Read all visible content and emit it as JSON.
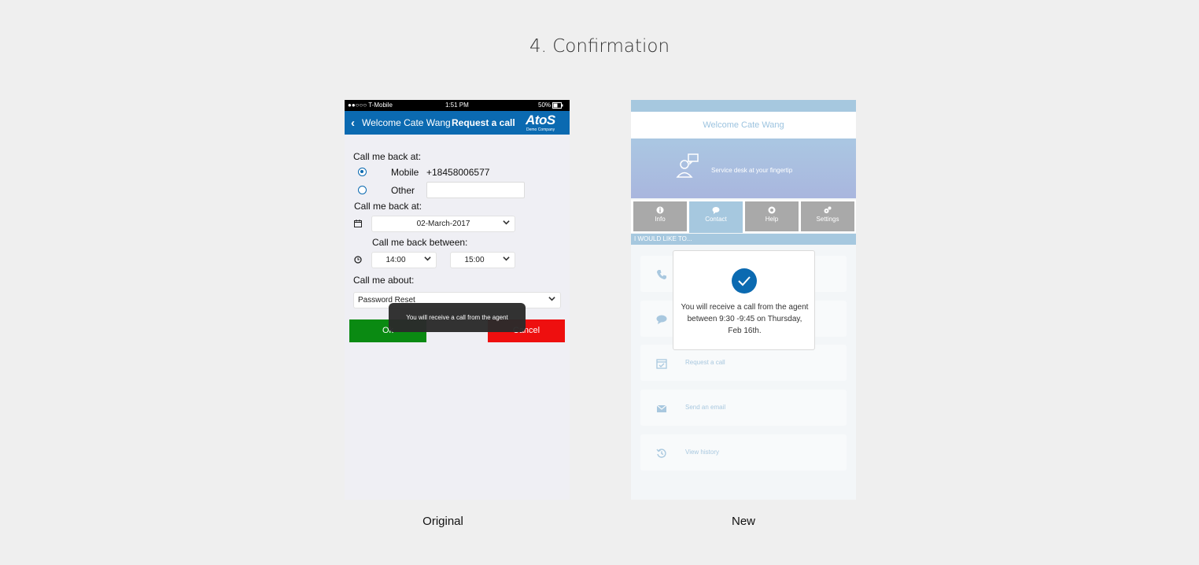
{
  "page": {
    "title": "4. Confirmation"
  },
  "captions": {
    "original": "Original",
    "new": "New"
  },
  "original": {
    "status": {
      "carrier": "●●○○○ T-Mobile",
      "time": "1:51 PM",
      "battery": "50%"
    },
    "nav": {
      "back_label": "Welcome Cate Wang",
      "title": "Request a call",
      "logo": "AtoS",
      "logo_sub": "Demo Company"
    },
    "form": {
      "label_call_me_back": "Call me back at:",
      "mobile_label": "Mobile",
      "mobile_number": "+18458006577",
      "other_label": "Other",
      "other_value": "",
      "label_call_me_back_date": "Call me back at:",
      "date_value": "02-March-2017",
      "label_between": "Call me back between:",
      "time_from": "14:00",
      "time_to": "15:00",
      "label_about": "Call me about:",
      "topic_value": "Password Reset",
      "ok_label": "Ok",
      "cancel_label": "Cancel"
    },
    "toast": "You will receive a call from the agent"
  },
  "new": {
    "header_title": "Welcome Cate Wang",
    "hero_tagline": "Service desk at your fingertip",
    "tabs": [
      {
        "label": "Info",
        "icon": "info-icon"
      },
      {
        "label": "Contact",
        "icon": "chat-icon"
      },
      {
        "label": "Help",
        "icon": "lifebuoy-icon"
      },
      {
        "label": "Settings",
        "icon": "gears-icon"
      }
    ],
    "section_label": "I WOULD LIKE TO...",
    "actions": [
      {
        "label": "",
        "icon": "phone-icon"
      },
      {
        "label": "",
        "icon": "chat-icon"
      },
      {
        "label": "Request a call",
        "icon": "calendar-check-icon"
      },
      {
        "label": "Send an email",
        "icon": "envelope-icon"
      },
      {
        "label": "View history",
        "icon": "history-icon"
      }
    ],
    "modal_message": "You will receive a call from the agent between 9:30 -9:45 on Thursday, Feb 16th.",
    "colors": {
      "accent": "#0b6ab1",
      "light_blue": "#a6c8df",
      "ok_green": "#0a8a12",
      "cancel_red": "#ee0f0f"
    }
  }
}
